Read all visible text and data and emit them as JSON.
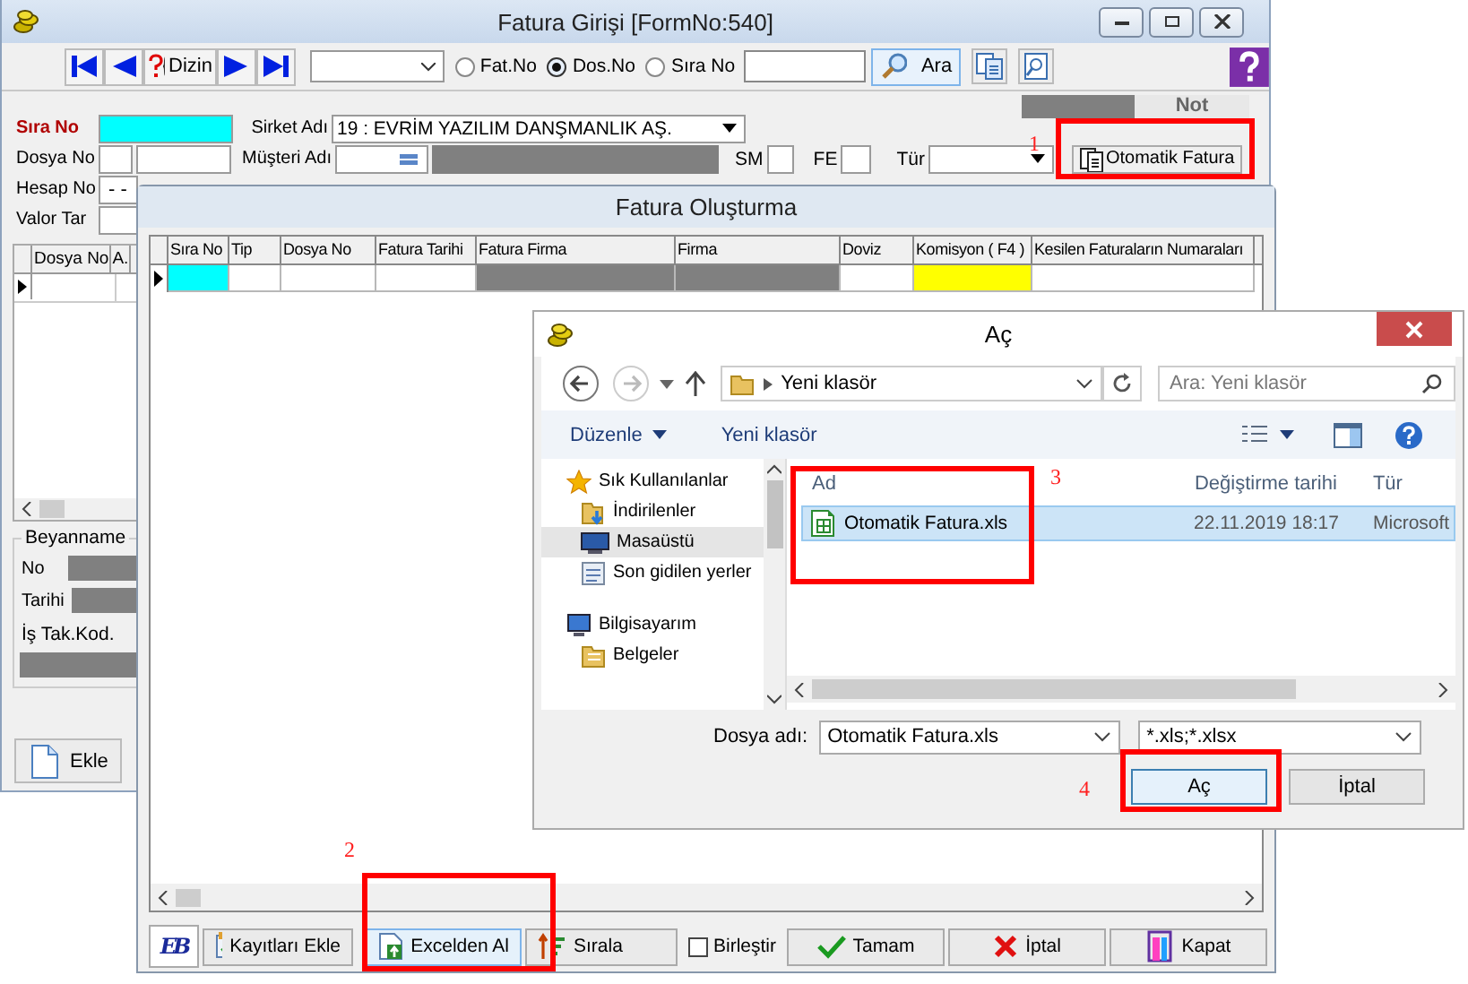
{
  "main_window": {
    "title": "Fatura Girişi [FormNo:540]",
    "nav_label": "Dizin",
    "search_modes": [
      {
        "label": "Fat.No",
        "selected": false
      },
      {
        "label": "Dos.No",
        "selected": true
      },
      {
        "label": "Sıra No",
        "selected": false
      }
    ],
    "search_button": "Ara",
    "labels": {
      "sira_no": "Sıra No",
      "dosya_no": "Dosya No",
      "hesap_no": "Hesap No",
      "valor_tar": "Valor Tar",
      "sirket": "Sirket Adı",
      "musteri": "Müşteri Adı",
      "sm": "SM",
      "fe": "FE",
      "tur": "Tür",
      "not": "Not"
    },
    "hesap_no_value": "- -",
    "sirket_value": "19 : EVRİM YAZILIM DANŞMANLIK AŞ.",
    "otomatik_button": "Otomatik Fatura",
    "grid_columns": [
      "Dosya No",
      "A."
    ],
    "beyanname": {
      "title": "Beyanname",
      "no": "No",
      "tarihi": "Tarihi",
      "is_tak_kod": "İş Tak.Kod."
    },
    "ekle_button": "Ekle"
  },
  "fatura_olusturma": {
    "title": "Fatura Oluşturma",
    "columns": [
      {
        "label": "Sıra No",
        "color": "#00ffff"
      },
      {
        "label": "Tip",
        "color": "#ffffff"
      },
      {
        "label": "Dosya No",
        "color": "#ffffff"
      },
      {
        "label": "Fatura Tarihi",
        "color": "#ffffff"
      },
      {
        "label": "Fatura Firma",
        "color": "#808080"
      },
      {
        "label": "Firma",
        "color": "#808080"
      },
      {
        "label": "Doviz",
        "color": "#ffffff"
      },
      {
        "label": "Komisyon ( F4 )",
        "color": "#ffff00"
      },
      {
        "label": "Kesilen Faturaların Numaraları",
        "color": "#ffffff"
      }
    ],
    "logo": "EB",
    "buttons": [
      {
        "label": "Kayıtları Ekle",
        "focused": false
      },
      {
        "label": "Excelden Al",
        "focused": true
      },
      {
        "label": "Sırala",
        "focused": false
      }
    ],
    "merge_checkbox": {
      "label": "Birleştir",
      "checked": false
    },
    "buttons_right": [
      {
        "label": "Tamam"
      },
      {
        "label": "İptal"
      },
      {
        "label": "Kapat"
      }
    ]
  },
  "open_dialog": {
    "title": "Aç",
    "address": "Yeni klasör",
    "search_placeholder": "Ara: Yeni klasör",
    "commands": [
      "Düzenle",
      "Yeni klasör"
    ],
    "tree": [
      {
        "label": "Sık Kullanılanlar",
        "selected": false,
        "children": [
          {
            "label": "İndirilenler",
            "selected": false
          },
          {
            "label": "Masaüstü",
            "selected": true
          },
          {
            "label": "Son gidilen yerler",
            "selected": false
          }
        ]
      },
      {
        "label": "Bilgisayarım",
        "selected": false,
        "children": [
          {
            "label": "Belgeler",
            "selected": false
          }
        ]
      }
    ],
    "columns": [
      "Ad",
      "Değiştirme tarihi",
      "Tür"
    ],
    "files": [
      {
        "name": "Otomatik Fatura.xls",
        "modified": "22.11.2019 18:17",
        "type": "Microsoft",
        "selected": true
      }
    ],
    "file_name_label": "Dosya adı:",
    "file_name": "Otomatik Fatura.xls",
    "filter": "*.xls;*.xlsx",
    "open_button": "Aç",
    "cancel_button": "İptal"
  },
  "annotations": [
    {
      "label": "1"
    },
    {
      "label": "2"
    },
    {
      "label": "3"
    },
    {
      "label": "4"
    }
  ]
}
